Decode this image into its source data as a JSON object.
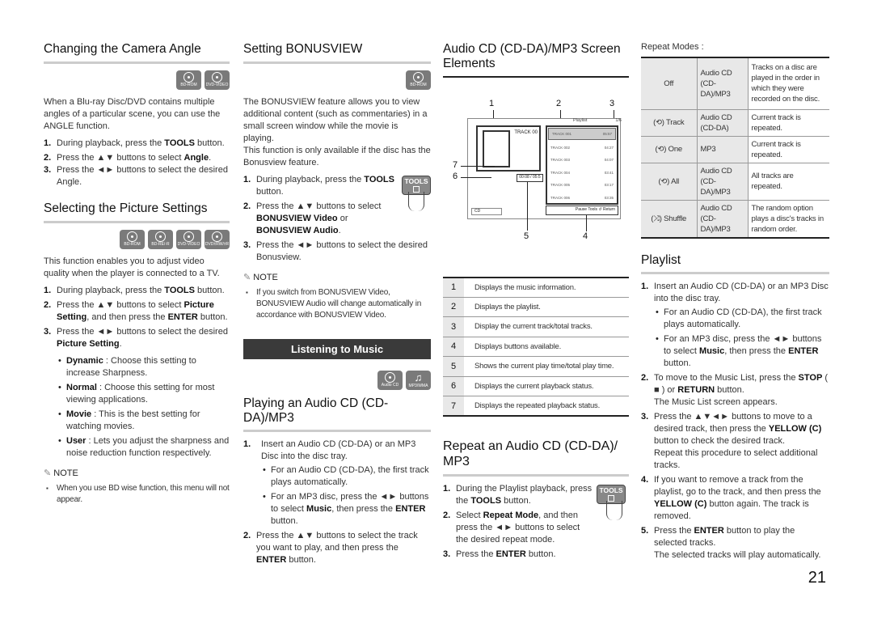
{
  "page_number": "21",
  "camera_angle": {
    "title": "Changing the Camera Angle",
    "discs": [
      "BD-ROM",
      "DVD-VIDEO"
    ],
    "intro": "When a Blu-ray Disc/DVD contains multiple angles of a particular scene, you can use the ANGLE function.",
    "steps": [
      {
        "num": "1.",
        "pre": "During playback, press the ",
        "bold": "TOOLS",
        "post": " button."
      },
      {
        "num": "2.",
        "pre": "Press the ▲▼ buttons to select ",
        "bold": "Angle",
        "post": "."
      },
      {
        "num": "3.",
        "pre": "Press the ◄► buttons to select the desired Angle.",
        "bold": "",
        "post": ""
      }
    ]
  },
  "picture_settings": {
    "title": "Selecting the Picture Settings",
    "discs": [
      "BD-ROM",
      "BD-RE/-R",
      "DVD-VIDEO",
      "DVD±RW/±R"
    ],
    "intro": "This function enables you to adjust video quality when the player is connected to a TV.",
    "step1": {
      "num": "1.",
      "pre": "During playback, press the ",
      "bold": "TOOLS",
      "post": " button."
    },
    "step2": {
      "num": "2.",
      "pre": "Press the ▲▼ buttons to select ",
      "bold1": "Picture Setting",
      "mid": ", and then press the ",
      "bold2": "ENTER",
      "post": " button."
    },
    "step3": {
      "num": "3.",
      "pre": "Press the ◄► buttons to select the desired ",
      "bold": "Picture Setting",
      "post": "."
    },
    "options": [
      {
        "name": "Dynamic",
        "desc": " : Choose this setting to increase Sharpness."
      },
      {
        "name": "Normal",
        "desc": " : Choose this setting for most viewing applications."
      },
      {
        "name": "Movie",
        "desc": " : This is the best setting for watching movies."
      },
      {
        "name": "User",
        "desc": " : Lets you adjust the sharpness and noise reduction function respectively."
      }
    ],
    "note_label": "NOTE",
    "note": "When you use BD wise function, this menu will not appear."
  },
  "bonusview": {
    "title": "Setting BONUSVIEW",
    "discs": [
      "BD-ROM"
    ],
    "intro1": "The BONUSVIEW feature allows you to view additional content (such as commentaries) in a small screen window while the movie is playing.",
    "intro2": "This function is only available if the disc has the Bonusview feature.",
    "tools_label": "TOOLS",
    "step1": {
      "num": "1.",
      "pre": "During playback, press the ",
      "bold": "TOOLS",
      "post": " button."
    },
    "step2": {
      "num": "2.",
      "pre": "Press the ▲▼ buttons to select ",
      "bold1": "BONUSVIEW Video",
      "mid": " or ",
      "bold2": "BONUSVIEW Audio",
      "post": "."
    },
    "step3": {
      "num": "3.",
      "text": "Press the ◄► buttons to select the desired Bonusview."
    },
    "note_label": "NOTE",
    "note": "If you switch from BONUSVIEW Video, BONUSVIEW Audio will change automatically in accordance with BONUSVIEW Video."
  },
  "listening_banner": "Listening to Music",
  "playing_cd": {
    "discs": [
      "Audio CD",
      "MP3/WMA"
    ],
    "title": "Playing an Audio CD (CD-DA)/MP3",
    "step1": {
      "num": "1.",
      "text": "Insert an Audio CD (CD-DA) or an MP3 Disc into the disc tray."
    },
    "bullets": [
      {
        "pre": "For an Audio CD (CD-DA), the first track plays automatically.",
        "bold": "",
        "mid": "",
        "bold2": "",
        "post": ""
      },
      {
        "pre": "For an MP3 disc, press the ◄► buttons to select ",
        "bold": "Music",
        "mid": ", then press the ",
        "bold2": "ENTER",
        "post": " button."
      }
    ],
    "step2": {
      "num": "2.",
      "pre": "Press the ▲▼ buttons to select the track you want to play, and then press the ",
      "bold": "ENTER",
      "post": " button."
    }
  },
  "screen_elements": {
    "title": "Audio CD (CD-DA)/MP3 Screen Elements",
    "diagram": {
      "track_label": "TRACK 00",
      "playlist_label": "Playlist",
      "track_count": "1/6",
      "time": "00:08 / 05:5",
      "cd_label": "CD",
      "buttons": "Pause  Tools  ↺ Return",
      "tracks": [
        {
          "name": "TRACK 001",
          "time": "05:57"
        },
        {
          "name": "TRACK 002",
          "time": "04:27"
        },
        {
          "name": "TRACK 003",
          "time": "04:07"
        },
        {
          "name": "TRACK 004",
          "time": "03:41"
        },
        {
          "name": "TRACK 005",
          "time": "03:17"
        },
        {
          "name": "TRACK 006",
          "time": "03:35"
        }
      ],
      "callouts": [
        "1",
        "2",
        "3",
        "4",
        "5",
        "6",
        "7"
      ]
    },
    "table": [
      {
        "num": "1",
        "desc": "Displays the music information."
      },
      {
        "num": "2",
        "desc": "Displays the playlist."
      },
      {
        "num": "3",
        "desc": "Display the current track/total tracks."
      },
      {
        "num": "4",
        "desc": "Displays buttons available."
      },
      {
        "num": "5",
        "desc": "Shows the current play time/total play time."
      },
      {
        "num": "6",
        "desc": "Displays the current playback status."
      },
      {
        "num": "7",
        "desc": "Displays the repeated playback status."
      }
    ]
  },
  "repeat_cd": {
    "title": "Repeat an Audio CD (CD-DA)/ MP3",
    "tools_label": "TOOLS",
    "step1": {
      "num": "1.",
      "pre": "During the Playlist playback, press the ",
      "bold": "TOOLS",
      "post": " button."
    },
    "step2": {
      "num": "2.",
      "pre": "Select ",
      "bold": "Repeat Mode",
      "post": ", and then press the ◄► buttons to select the desired repeat mode."
    },
    "step3": {
      "num": "3.",
      "pre": "Press the ",
      "bold": "ENTER",
      "post": " button."
    }
  },
  "repeat_modes": {
    "label": "Repeat Modes :",
    "rows": [
      {
        "mode": "Off",
        "icon": "",
        "type": "Audio CD (CD-DA)/MP3",
        "desc": "Tracks on a disc are played in the order in which they were recorded on the disc."
      },
      {
        "mode": "Track",
        "icon": "(⟲)",
        "type": "Audio CD (CD-DA)",
        "desc": "Current track is repeated."
      },
      {
        "mode": "One",
        "icon": "(⟲)",
        "type": "MP3",
        "desc": "Current track is repeated."
      },
      {
        "mode": "All",
        "icon": "(⟲)",
        "type": "Audio CD (CD-DA)/MP3",
        "desc": "All tracks are repeated."
      },
      {
        "mode": "Shuffle",
        "icon": "(⤨)",
        "type": "Audio CD (CD-DA)/MP3",
        "desc": "The random option plays a disc's tracks in random order."
      }
    ]
  },
  "playlist": {
    "title": "Playlist",
    "step1": {
      "num": "1.",
      "text": "Insert an Audio CD (CD-DA) or an MP3 Disc into the disc tray."
    },
    "bullets": [
      {
        "pre": "For an Audio CD (CD-DA), the first track plays automatically.",
        "bold": "",
        "mid": "",
        "bold2": "",
        "post": ""
      },
      {
        "pre": "For an MP3 disc, press the ◄► buttons to select ",
        "bold": "Music",
        "mid": ", then press the ",
        "bold2": "ENTER",
        "post": " button."
      }
    ],
    "step2": {
      "num": "2.",
      "pre": "To move to the Music List, press the ",
      "bold": "STOP",
      "mid": " ( ■ ) or ",
      "bold2": "RETURN",
      "post": " button.",
      "extra": "The Music List screen appears."
    },
    "step3": {
      "num": "3.",
      "pre": "Press the ▲▼◄► buttons to move to a desired track, then press the ",
      "bold": "YELLOW (C)",
      "post": " button to check the desired track.",
      "extra": "Repeat this procedure to select additional tracks."
    },
    "step4": {
      "num": "4.",
      "pre": "If you want to remove a track from the playlist, go to the track, and then press the ",
      "bold": "YELLOW (C)",
      "post": " button again. The track is removed."
    },
    "step5": {
      "num": "5.",
      "pre": "Press the ",
      "bold": "ENTER",
      "post": " button to play the selected tracks.",
      "extra": "The selected tracks will play automatically."
    }
  }
}
